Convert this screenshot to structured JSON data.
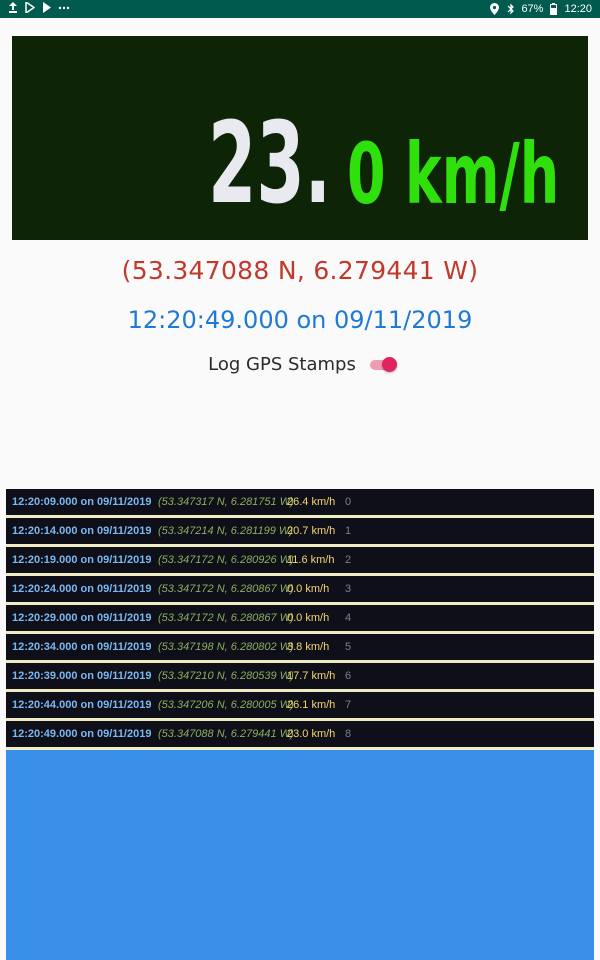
{
  "status_bar": {
    "left_icons": [
      "upload-icon",
      "play-store-icon",
      "play-store-alt-icon",
      "more-icon"
    ],
    "right_icons": [
      "location-icon",
      "bluetooth-icon",
      "battery-icon"
    ],
    "battery": "67%",
    "clock": "12:20"
  },
  "speed": {
    "integer_part": "23.",
    "decimal_and_unit": "0 km/h",
    "colors": {
      "integer": "#e8eaf0",
      "decimal": "#2fe00c",
      "background": "#0d2506"
    }
  },
  "location": {
    "coordinates": "(53.347088 N, 6.279441 W)",
    "timestamp": "12:20:49.000 on 09/11/2019"
  },
  "log_toggle": {
    "label": "Log GPS Stamps",
    "on": true
  },
  "log": {
    "rows": [
      {
        "time": "12:20:09.000 on 09/11/2019",
        "coords": "(53.347317 N, 6.281751 W)",
        "speed": "26.4 km/h",
        "index": "0"
      },
      {
        "time": "12:20:14.000 on 09/11/2019",
        "coords": "(53.347214 N, 6.281199 W)",
        "speed": "20.7 km/h",
        "index": "1"
      },
      {
        "time": "12:20:19.000 on 09/11/2019",
        "coords": "(53.347172 N, 6.280926 W)",
        "speed": "11.6 km/h",
        "index": "2"
      },
      {
        "time": "12:20:24.000 on 09/11/2019",
        "coords": "(53.347172 N, 6.280867 W)",
        "speed": "0.0 km/h",
        "index": "3"
      },
      {
        "time": "12:20:29.000 on 09/11/2019",
        "coords": "(53.347172 N, 6.280867 W)",
        "speed": "0.0 km/h",
        "index": "4"
      },
      {
        "time": "12:20:34.000 on 09/11/2019",
        "coords": "(53.347198 N, 6.280802 W)",
        "speed": "3.8 km/h",
        "index": "5"
      },
      {
        "time": "12:20:39.000 on 09/11/2019",
        "coords": "(53.347210 N, 6.280539 W)",
        "speed": "17.7 km/h",
        "index": "6"
      },
      {
        "time": "12:20:44.000 on 09/11/2019",
        "coords": "(53.347206 N, 6.280005 W)",
        "speed": "26.1 km/h",
        "index": "7"
      },
      {
        "time": "12:20:49.000 on 09/11/2019",
        "coords": "(53.347088 N, 6.279441 W)",
        "speed": "23.0 km/h",
        "index": "8"
      }
    ]
  }
}
